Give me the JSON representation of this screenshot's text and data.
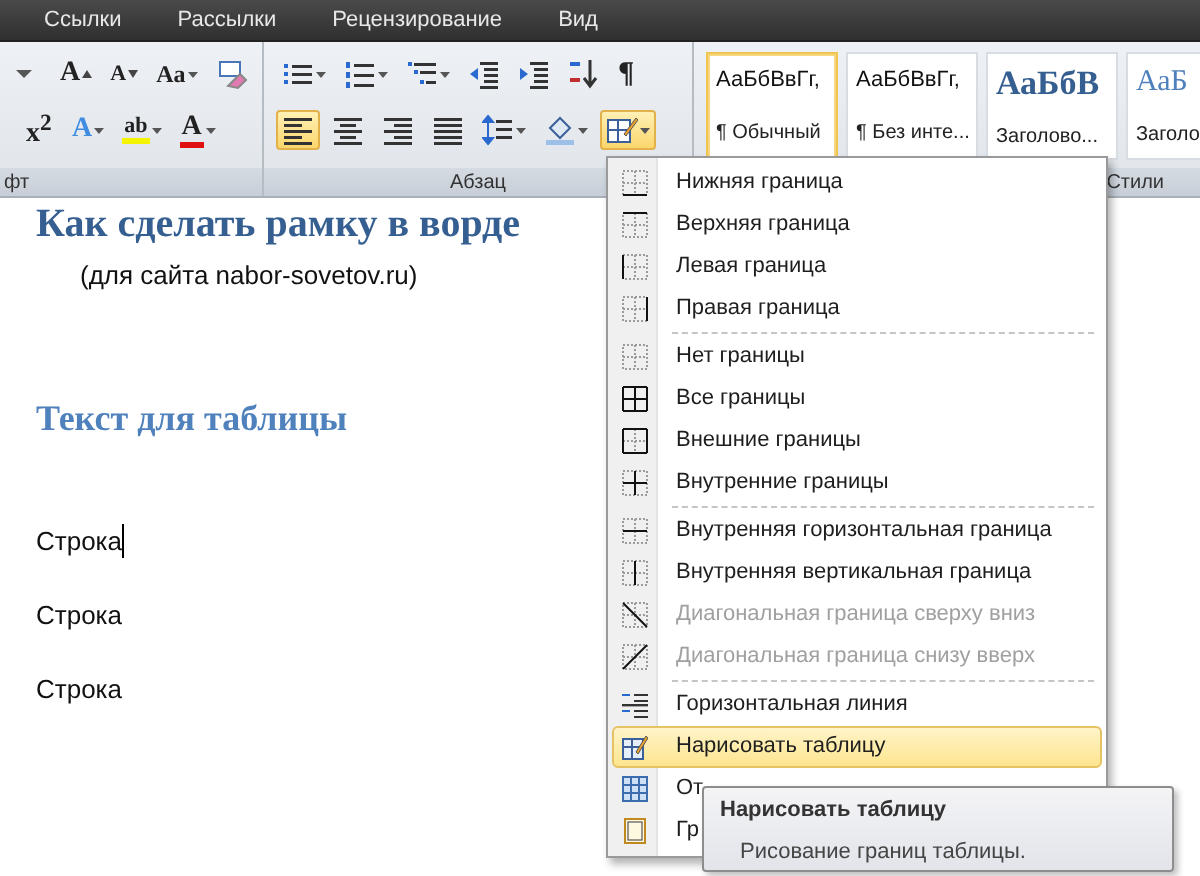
{
  "ribbon_tabs": [
    "Ссылки",
    "Рассылки",
    "Рецензирование",
    "Вид"
  ],
  "font_group": {
    "label": "фт",
    "rows": [
      [
        {
          "kind": "size-dropdown"
        },
        {
          "kind": "grow",
          "text": "A"
        },
        {
          "kind": "shrink",
          "text": "A"
        },
        {
          "kind": "case",
          "text": "Aa",
          "dropdown": true
        },
        {
          "kind": "clear"
        }
      ],
      [
        {
          "kind": "superscript",
          "text": "x$^{2}$"
        },
        {
          "kind": "effects",
          "text": "A",
          "dropdown": true
        },
        {
          "kind": "highlight",
          "text": "ab",
          "dropdown": true
        },
        {
          "kind": "font-color",
          "text": "A",
          "dropdown": true
        }
      ]
    ]
  },
  "paragraph_group": {
    "label": "Абзац",
    "rows": [
      [
        {
          "kind": "bullets",
          "dropdown": true,
          "selected": false
        },
        {
          "kind": "numbering",
          "dropdown": true,
          "selected": false
        },
        {
          "kind": "multilevel",
          "dropdown": true,
          "selected": false
        },
        {
          "kind": "outdent",
          "dropdown": false,
          "selected": false
        },
        {
          "kind": "indent",
          "dropdown": false,
          "selected": false
        },
        {
          "kind": "sort",
          "dropdown": false,
          "selected": false
        },
        {
          "kind": "pilcrow",
          "text": "¶",
          "dropdown": false,
          "selected": false
        }
      ],
      [
        {
          "kind": "align-left",
          "dropdown": false,
          "selected": true
        },
        {
          "kind": "align-center",
          "dropdown": false,
          "selected": false
        },
        {
          "kind": "align-right",
          "dropdown": false,
          "selected": false
        },
        {
          "kind": "justify",
          "dropdown": false,
          "selected": false
        },
        {
          "kind": "line-spacing",
          "dropdown": true,
          "selected": false
        },
        {
          "kind": "shading",
          "dropdown": true,
          "selected": false
        },
        {
          "kind": "borders",
          "dropdown": true,
          "selected": true
        }
      ]
    ]
  },
  "styles_group": {
    "label": "Стили",
    "styles": [
      {
        "kind": "normal",
        "sample": "АаБбВвГг,",
        "name": "¶ Обычный",
        "selected": true
      },
      {
        "kind": "normal",
        "sample": "АаБбВвГг,",
        "name": "¶ Без инте...",
        "selected": false
      },
      {
        "kind": "heading1",
        "sample": "АаБбВ",
        "name": "Заголово...",
        "selected": false
      },
      {
        "kind": "heading2",
        "sample": "АаБ",
        "name": "Заголо",
        "selected": false
      }
    ]
  },
  "document": {
    "title": "Как сделать рамку в ворде",
    "subtitle": "(для сайта nabor-sovetov.ru)",
    "heading": "Текст для таблицы",
    "lines": [
      {
        "text": "Строка",
        "cursor": true
      },
      {
        "text": "Строка",
        "cursor": false
      },
      {
        "text": "Строка",
        "cursor": false
      }
    ]
  },
  "borders_menu": {
    "groups": [
      [
        {
          "kind": "bottom",
          "label": "Нижняя граница",
          "disabled": false,
          "highlighted": false
        },
        {
          "kind": "top",
          "label": "Верхняя граница",
          "disabled": false,
          "highlighted": false
        },
        {
          "kind": "left",
          "label": "Левая граница",
          "disabled": false,
          "highlighted": false
        },
        {
          "kind": "right",
          "label": "Правая граница",
          "disabled": false,
          "highlighted": false
        }
      ],
      [
        {
          "kind": "none",
          "label": "Нет границы",
          "disabled": false,
          "highlighted": false
        },
        {
          "kind": "all",
          "label": "Все границы",
          "disabled": false,
          "highlighted": false
        },
        {
          "kind": "outside",
          "label": "Внешние границы",
          "disabled": false,
          "highlighted": false
        },
        {
          "kind": "inside",
          "label": "Внутренние границы",
          "disabled": false,
          "highlighted": false
        }
      ],
      [
        {
          "kind": "inside-h",
          "label": "Внутренняя горизонтальная граница",
          "disabled": false,
          "highlighted": false
        },
        {
          "kind": "inside-v",
          "label": "Внутренняя вертикальная граница",
          "disabled": false,
          "highlighted": false
        },
        {
          "kind": "diag-down",
          "label": "Диагональная граница сверху вниз",
          "disabled": true,
          "highlighted": false
        },
        {
          "kind": "diag-up",
          "label": "Диагональная граница снизу вверх",
          "disabled": true,
          "highlighted": false
        }
      ],
      [
        {
          "kind": "hline",
          "label": "Горизонтальная линия",
          "disabled": false,
          "highlighted": false
        },
        {
          "kind": "draw-table",
          "label": "Нарисовать таблицу",
          "disabled": false,
          "highlighted": true
        },
        {
          "kind": "gridlines",
          "label": "От",
          "disabled": false,
          "highlighted": false
        },
        {
          "kind": "borders-shading",
          "label": "Гр",
          "disabled": false,
          "highlighted": false
        }
      ]
    ]
  },
  "tooltip": {
    "title": "Нарисовать таблицу",
    "description": "Рисование границ таблицы."
  }
}
